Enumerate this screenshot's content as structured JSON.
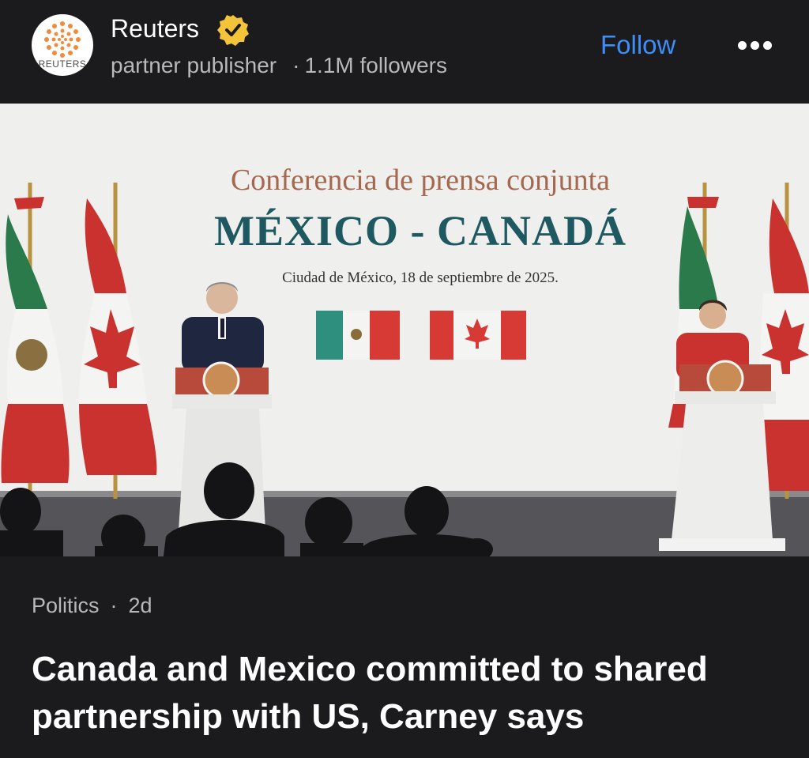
{
  "publisher": {
    "name": "Reuters",
    "logo_wordmark": "REUTERS",
    "type": "partner publisher",
    "separator": "·",
    "followers": "1.1M followers",
    "verified_icon": "verified-badge-icon"
  },
  "actions": {
    "follow_label": "Follow",
    "more_icon": "more-options-icon"
  },
  "photo": {
    "banner_line1": "Conferencia de prensa conjunta",
    "banner_line2": "MÉXICO - CANADÁ",
    "banner_line3": "Ciudad de México, 18 de septiembre de 2025."
  },
  "article": {
    "category": "Politics",
    "separator": "·",
    "age": "2d",
    "headline": "Canada and Mexico committed to shared partnership with US, Carney says"
  },
  "colors": {
    "background": "#1b1b1d",
    "accent": "#3d8ef7",
    "verified": "#f3c43a",
    "secondary_text": "#b9b9bd"
  }
}
